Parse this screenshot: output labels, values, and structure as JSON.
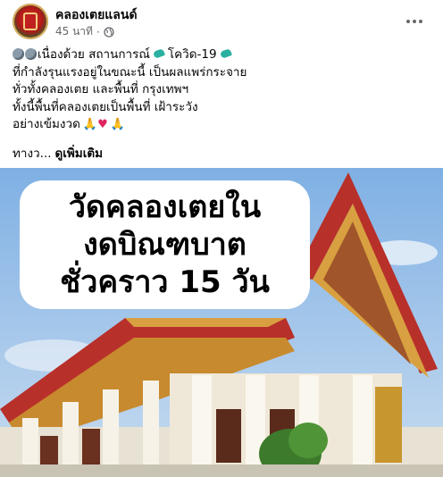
{
  "post": {
    "page_name": "คลองเตยแลนด์",
    "time_ago": "45 นาที",
    "dot": "·",
    "text_lines": {
      "l1_a": "เนื่องด้วย สถานการณ์",
      "l1_b": "โควิด-19",
      "l2": "ที่กำลังรุนแรงอยู่ในขณะนี้ เป็นผลแพร่กระจาย",
      "l3": "ทั่วทั้งคลองเตย และพื้นที่ กรุงเทพฯ",
      "l4": "ทั้งนี้พื้นที่คลองเตยเป็นพื้นที่ เฝ้าระวัง",
      "l5": "อย่างเข้มงวด"
    },
    "truncated_text": "ทางว...",
    "see_more_label": "ดูเพิ่มเติม"
  },
  "image": {
    "headline_lines": [
      "วัดคลองเตยใน",
      "งดบิณฑบาต",
      "ชั่วคราว 15 วัน"
    ]
  },
  "icons": [
    "avatar",
    "globe-icon",
    "more-options-icon",
    "mask-emoji",
    "virus-emoji",
    "pray-emoji",
    "heart-emoji"
  ],
  "colors": {
    "text": "#050505",
    "meta": "#65676b",
    "roof_red": "#b8302a",
    "roof_gold": "#d8a040",
    "sky": "#8fb9e6"
  }
}
